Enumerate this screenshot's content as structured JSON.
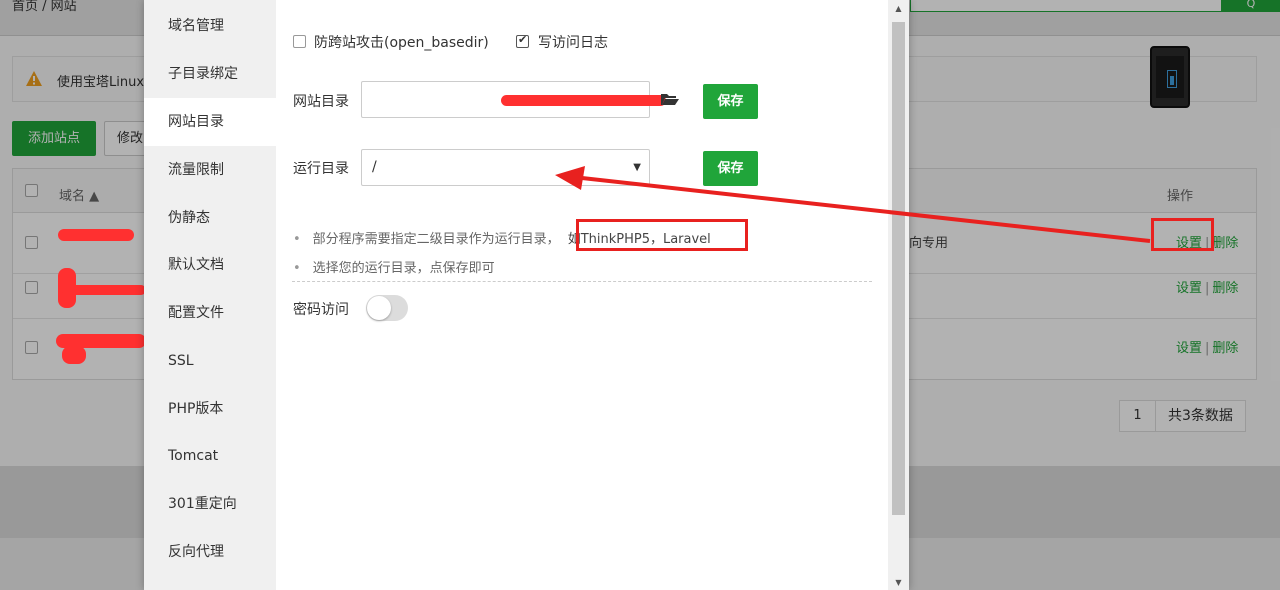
{
  "background": {
    "breadcrumb": "首页 / 网站",
    "search_button": "Q",
    "warning_text": "使用宝塔Linux",
    "add_site_button": "添加站点",
    "edit_button": "修改",
    "table_header": {
      "domain": "域名 ▲",
      "operations": "操作"
    },
    "rows": [
      {
        "note": "向专用",
        "ops_settings": "设置",
        "ops_sep": "|",
        "ops_delete": "删除"
      },
      {
        "note": "",
        "ops_settings": "设置",
        "ops_sep": "|",
        "ops_delete": "删除"
      },
      {
        "note": "",
        "ops_settings": "设置",
        "ops_sep": "|",
        "ops_delete": "删除"
      }
    ],
    "pager": {
      "page": "1",
      "total": "共3条数据"
    }
  },
  "modal": {
    "side_menu": [
      {
        "label": "域名管理",
        "active": false
      },
      {
        "label": "子目录绑定",
        "active": false
      },
      {
        "label": "网站目录",
        "active": true
      },
      {
        "label": "流量限制",
        "active": false
      },
      {
        "label": "伪静态",
        "active": false
      },
      {
        "label": "默认文档",
        "active": false
      },
      {
        "label": "配置文件",
        "active": false
      },
      {
        "label": "SSL",
        "active": false
      },
      {
        "label": "PHP版本",
        "active": false
      },
      {
        "label": "Tomcat",
        "active": false
      },
      {
        "label": "301重定向",
        "active": false
      },
      {
        "label": "反向代理",
        "active": false
      }
    ],
    "open_basedir_label": "防跨站攻击(open_basedir)",
    "open_basedir_checked": false,
    "access_log_label": "写访问日志",
    "access_log_checked": true,
    "site_dir_label": "网站目录",
    "site_dir_value": "",
    "run_dir_label": "运行目录",
    "run_dir_value": "/",
    "save_label": "保存",
    "tips": [
      {
        "prefix": "部分程序需要指定二级目录作为运行目录，",
        "highlight": "如ThinkPHP5，Laravel"
      },
      {
        "prefix": "选择您的运行目录，点保存即可",
        "highlight": ""
      }
    ],
    "password_access_label": "密码访问",
    "password_access_enabled": false
  },
  "colors": {
    "accent_green": "#20a53a",
    "annotation_red": "#e8211f"
  }
}
